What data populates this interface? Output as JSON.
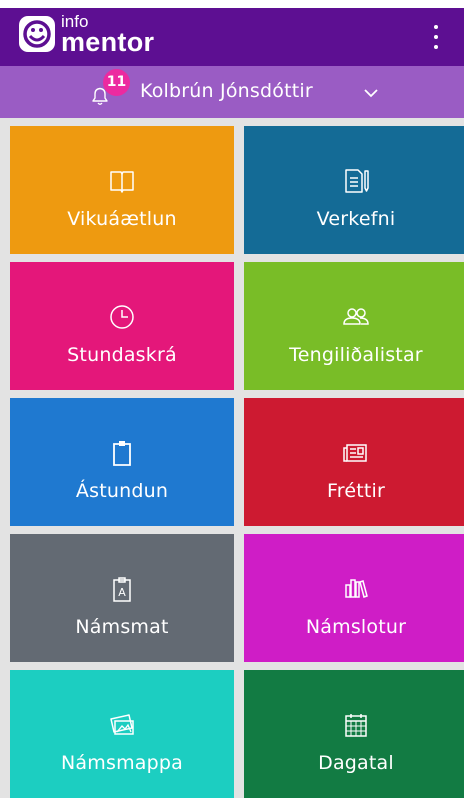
{
  "app": {
    "logo_small": "info",
    "logo_big": "mentor",
    "notification_count": "11",
    "user_name": "Kolbrún Jónsdóttir"
  },
  "tiles": [
    {
      "label": "Vikuáætlun",
      "color": "#ee9a10",
      "icon": "book-icon"
    },
    {
      "label": "Verkefni",
      "color": "#146b96",
      "icon": "document-pen-icon"
    },
    {
      "label": "Stundaskrá",
      "color": "#e4177a",
      "icon": "clock-icon"
    },
    {
      "label": "Tengiliðalistar",
      "color": "#79bd27",
      "icon": "contacts-icon"
    },
    {
      "label": "Ástundun",
      "color": "#1f79d0",
      "icon": "clipboard-icon"
    },
    {
      "label": "Fréttir",
      "color": "#cd1a31",
      "icon": "newspaper-icon"
    },
    {
      "label": "Námsmat",
      "color": "#636a73",
      "icon": "grade-clipboard-icon"
    },
    {
      "label": "Námslotur",
      "color": "#cf1dc6",
      "icon": "books-icon"
    },
    {
      "label": "Námsmappa",
      "color": "#1ccec1",
      "icon": "photos-icon"
    },
    {
      "label": "Dagatal",
      "color": "#127b43",
      "icon": "calendar-icon"
    }
  ],
  "colors": {
    "appbar": "#5d0f92",
    "userbar": "#9a5cc4",
    "badge": "#ec2aa0"
  }
}
